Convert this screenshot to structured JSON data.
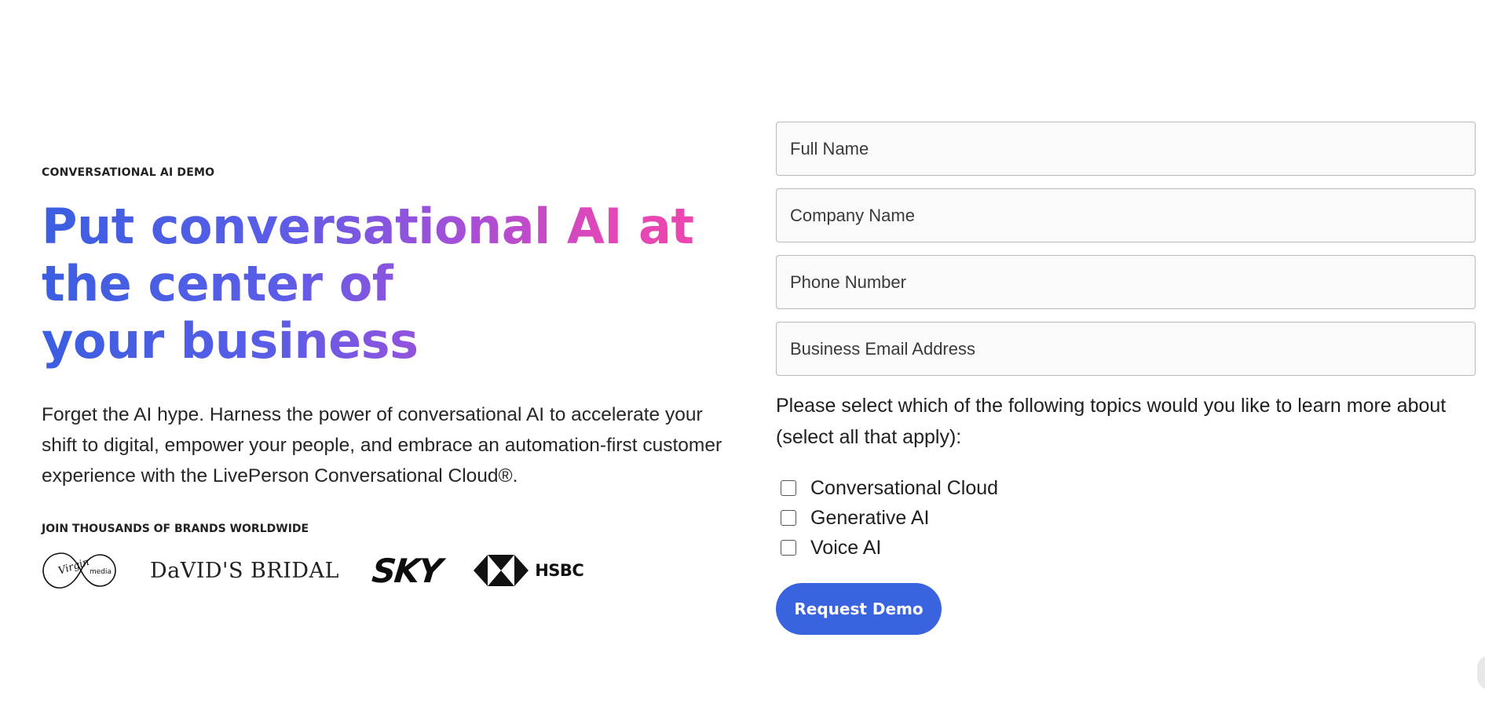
{
  "hero": {
    "eyebrow": "CONVERSATIONAL AI DEMO",
    "headline_lines": [
      "Put conversational AI at",
      "the center of",
      "your business"
    ],
    "intro": "Forget the AI hype. Harness the power of conversational AI to accelerate your shift to digital, empower your people, and embrace an automation-first customer experience with the LivePerson Conversational Cloud®.",
    "brands_label": "JOIN THOUSANDS OF BRANDS WORLDWIDE",
    "logos": {
      "virgin_word": "Virgin",
      "virgin_media": "media",
      "davids": "DaVID'S BRIDAL",
      "sky": "SKY",
      "hsbc": "HSBC"
    }
  },
  "form": {
    "full_name_placeholder": "Full Name",
    "company_placeholder": "Company Name",
    "phone_placeholder": "Phone Number",
    "email_placeholder": "Business Email Address",
    "topics_question": "Please select which of the following topics would you like to learn more about (select all that apply):",
    "topics": [
      "Conversational Cloud",
      "Generative AI",
      "Voice AI"
    ],
    "submit_label": "Request Demo"
  },
  "colors": {
    "accent": "#3a63e0",
    "gradient_start": "#3b5ee0",
    "gradient_end": "#ee46ad"
  }
}
